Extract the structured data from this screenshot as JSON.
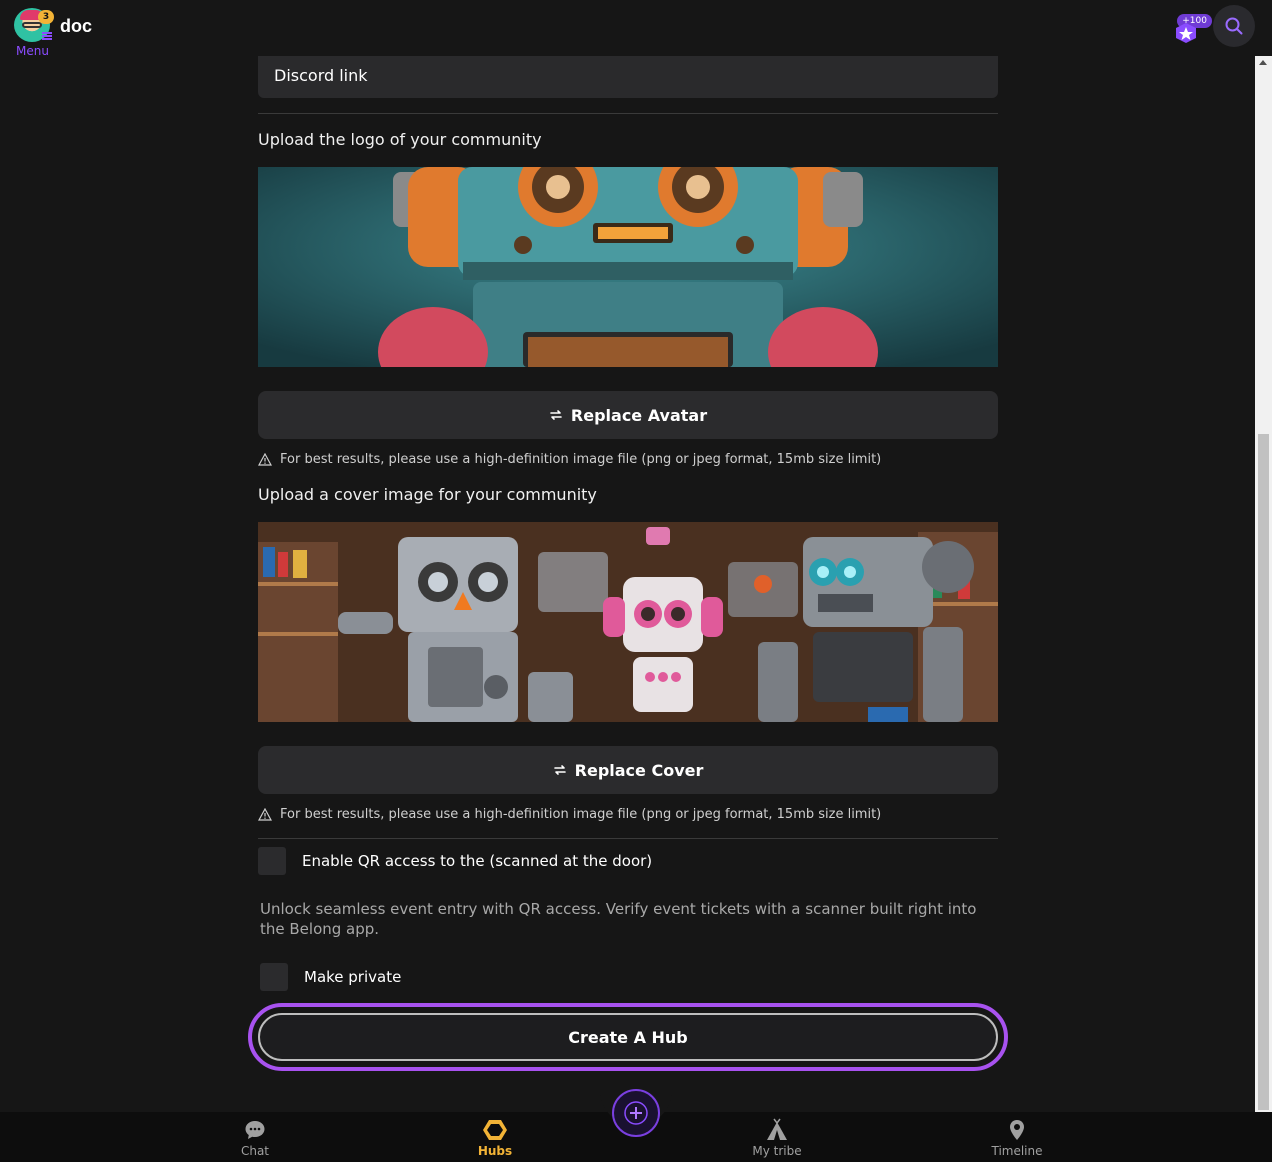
{
  "header": {
    "app_name": "doc",
    "menu_label": "Menu",
    "notification_count": "3",
    "points_badge": "+100"
  },
  "form": {
    "discord_field": {
      "placeholder": "Discord link",
      "value": ""
    },
    "logo": {
      "title": "Upload the logo of your community",
      "replace_label": "Replace Avatar",
      "hint": "For best results, please use a high-definition image file (png or jpeg format, 15mb size limit)"
    },
    "cover": {
      "title": "Upload a cover image for your community",
      "replace_label": "Replace Cover",
      "hint": "For best results, please use a high-definition image file (png or jpeg format, 15mb size limit)"
    },
    "qr_access": {
      "label": "Enable QR access to the (scanned at the door)",
      "checked": false,
      "description": "Unlock seamless event entry with QR access. Verify event tickets with a scanner built right into the Belong app."
    },
    "private": {
      "label": "Make private",
      "checked": false
    },
    "submit_label": "Create A Hub"
  },
  "bottom_nav": {
    "items": [
      {
        "label": "Chat",
        "icon": "chat-bubble-icon",
        "active": false
      },
      {
        "label": "Hubs",
        "icon": "hexagon-icon",
        "active": true
      },
      {
        "label": "My tribe",
        "icon": "tent-icon",
        "active": false
      },
      {
        "label": "Timeline",
        "icon": "location-pin-icon",
        "active": false
      }
    ],
    "fab_icon": "plus-icon"
  },
  "colors": {
    "background": "#161616",
    "accent_purple": "#a852ef",
    "active_yellow": "#f2b336"
  }
}
